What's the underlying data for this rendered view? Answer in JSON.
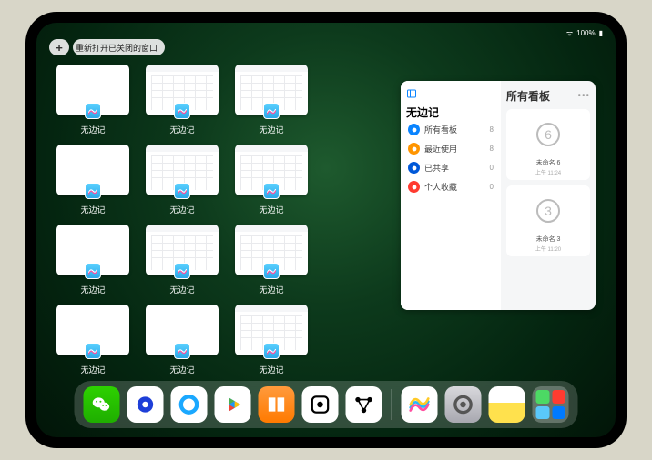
{
  "status": {
    "battery": "100%",
    "wifi": "▲"
  },
  "topbar": {
    "plus": "+",
    "pill_label": "重新打开已关闭的窗口"
  },
  "thumbnails": {
    "app_label": "无边记",
    "items": [
      {
        "style": "blank"
      },
      {
        "style": "cal"
      },
      {
        "style": "cal"
      },
      {
        "style": "blank"
      },
      {
        "style": "cal"
      },
      {
        "style": "cal"
      },
      {
        "style": "blank"
      },
      {
        "style": "cal"
      },
      {
        "style": "cal"
      },
      {
        "style": "blank"
      },
      {
        "style": "blank"
      },
      {
        "style": "cal"
      }
    ]
  },
  "panel": {
    "left": {
      "title": "无边记",
      "categories": [
        {
          "icon_color": "#0a84ff",
          "label": "所有看板",
          "count": 8
        },
        {
          "icon_color": "#ff9500",
          "label": "最近使用",
          "count": 8
        },
        {
          "icon_color": "#0058d8",
          "label": "已共享",
          "count": 0
        },
        {
          "icon_color": "#ff3b30",
          "label": "个人收藏",
          "count": 0
        }
      ]
    },
    "right": {
      "title": "所有看板",
      "dots": "•••",
      "boards": [
        {
          "name": "未命名 6",
          "time": "上午 11:24",
          "digit": "6"
        },
        {
          "name": "未命名 3",
          "time": "上午 11:20",
          "digit": "3"
        }
      ]
    }
  },
  "dock": {
    "apps": [
      {
        "name": "wechat",
        "bg": "linear-gradient(#2dd100,#1fae00)",
        "glyph": "wechat"
      },
      {
        "name": "browser-1",
        "bg": "#fff",
        "glyph": "circle-blue"
      },
      {
        "name": "browser-2",
        "bg": "#fff",
        "glyph": "ring-blue"
      },
      {
        "name": "play",
        "bg": "#fff",
        "glyph": "play"
      },
      {
        "name": "books",
        "bg": "linear-gradient(#ff9a3c,#ff7a00)",
        "glyph": "books"
      },
      {
        "name": "dice",
        "bg": "#fff",
        "glyph": "dot-square"
      },
      {
        "name": "graph",
        "bg": "#fff",
        "glyph": "nodes"
      }
    ],
    "recent": [
      {
        "name": "freeform",
        "bg": "#fff",
        "glyph": "freeform"
      },
      {
        "name": "settings",
        "bg": "linear-gradient(#d8d8dc,#a8a8b0)",
        "glyph": "gear"
      },
      {
        "name": "notes",
        "bg": "linear-gradient(#fff 45%,#ffe14d 45%)",
        "glyph": ""
      }
    ],
    "folder": {
      "tiles": [
        "#4cd964",
        "#ff3b30",
        "#5ac8fa",
        "#007aff"
      ]
    }
  }
}
